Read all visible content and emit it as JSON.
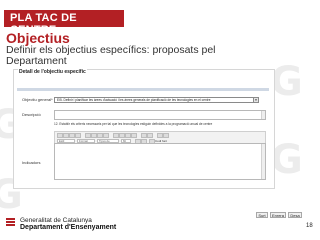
{
  "header": {
    "title": "PLA TAC DE CENTRE"
  },
  "slide": {
    "title": "Objectius",
    "subtitle": "Definir els objectius específics: proposats pel Departament"
  },
  "form": {
    "section_title": "Detall de l'objectiu específic",
    "objective_label": "Objectiu general*",
    "objective_value": "EI5. Definir i planificar les àrees d'actuació i les àrees generals de planificació de les tecnologies en el centre",
    "description_label": "Descripció",
    "detail_text": "12. Establir els criteris necessaris per tal que les tecnologies estiguin definides a la programació anual de centre",
    "indicators_label": "Indicadors",
    "toolbar": {
      "style_placeholder": "Estil",
      "format_placeholder": "Format",
      "font_placeholder": "Tipus de",
      "size_placeholder": "Mi",
      "code_label": "Codi font"
    }
  },
  "buttons": {
    "save": "Surt",
    "back": "Enrera",
    "close": "Desa"
  },
  "footer": {
    "org_line1": "Generalitat de Catalunya",
    "org_line2": "Departament d'Ensenyament",
    "page_number": "18"
  },
  "colors": {
    "accent": "#b32024",
    "watermark": "#ececec",
    "panel_bar": "#cfd8e4"
  }
}
